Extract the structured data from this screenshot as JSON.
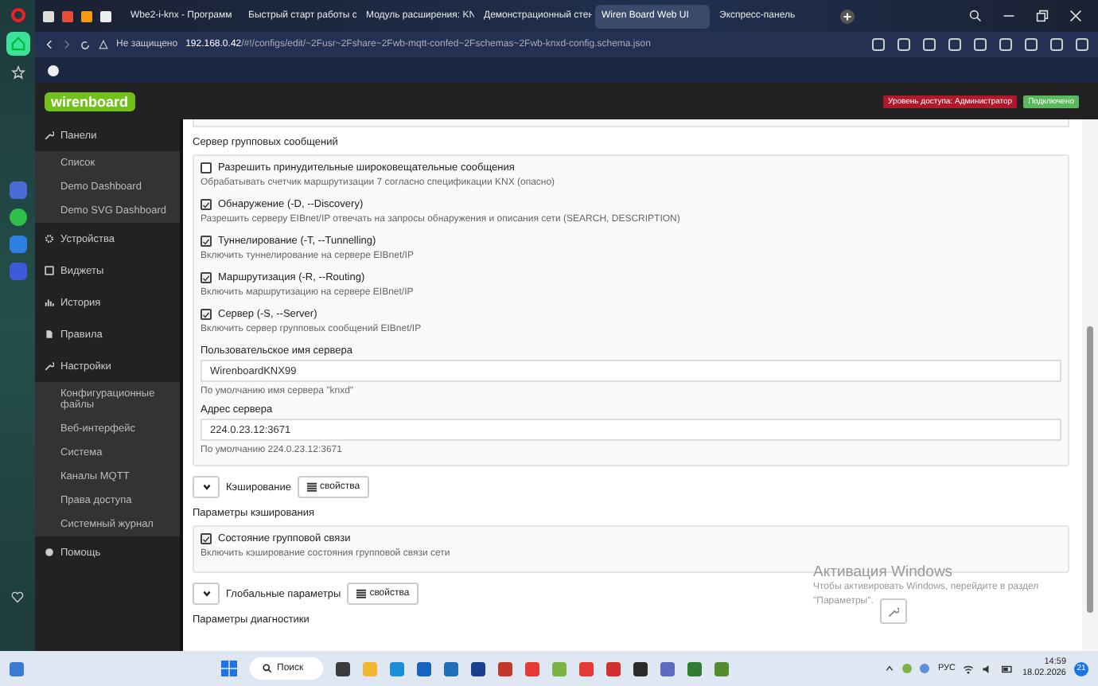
{
  "browser": {
    "tabs": [
      {
        "label": "Wbe2-i-knx - Программ",
        "selected": false
      },
      {
        "label": "Быстрый старт работы с",
        "selected": false
      },
      {
        "label": "Модуль расширения: KN",
        "selected": false
      },
      {
        "label": "Демонстрационный стен",
        "selected": false
      },
      {
        "label": "Wiren Board Web UI",
        "selected": true
      },
      {
        "label": "Экспресс-панель",
        "selected": false
      }
    ],
    "security": "Не защищено",
    "url_host": "192.168.0.42",
    "url_path": "/#!/configs/edit/~2Fusr~2Fshare~2Fwb-mqtt-confed~2Fschemas~2Fwb-knxd-config.schema.json"
  },
  "header": {
    "logo": "wirenboard",
    "access_badge": "Уровень доступа: Администратор",
    "status_badge": "Подключено"
  },
  "sidebar": {
    "items": [
      {
        "label": "Панели",
        "children": [
          {
            "label": "Список"
          },
          {
            "label": "Demo Dashboard"
          },
          {
            "label": "Demo SVG Dashboard"
          }
        ]
      },
      {
        "label": "Устройства"
      },
      {
        "label": "Виджеты"
      },
      {
        "label": "История"
      },
      {
        "label": "Правила"
      },
      {
        "label": "Настройки",
        "children": [
          {
            "label": "Конфигурационные файлы"
          },
          {
            "label": "Веб-интерфейс"
          },
          {
            "label": "Система"
          },
          {
            "label": "Каналы MQTT"
          },
          {
            "label": "Права доступа"
          },
          {
            "label": "Системный журнал"
          }
        ]
      },
      {
        "label": "Помощь"
      }
    ]
  },
  "content": {
    "section_title": "Сервер групповых сообщений",
    "options": [
      {
        "label": "Разрешить принудительные широковещательные сообщения",
        "checked": false,
        "hint": "Обрабатывать счетчик маршрутизации 7 согласно спецификации KNX (опасно)"
      },
      {
        "label": "Обнаружение (-D, --Discovery)",
        "checked": true,
        "hint": "Разрешить серверу EIBnet/IP отвечать на запросы обнаружения и описания сети (SEARCH, DESCRIPTION)"
      },
      {
        "label": "Туннелирование (-T, --Tunnelling)",
        "checked": true,
        "hint": "Включить туннелирование на сервере EIBnet/IP"
      },
      {
        "label": "Маршрутизация (-R, --Routing)",
        "checked": true,
        "hint": "Включить маршрутизацию на сервере EIBnet/IP"
      },
      {
        "label": "Сервер (-S, --Server)",
        "checked": true,
        "hint": "Включить сервер групповых сообщений EIBnet/IP"
      }
    ],
    "fields": [
      {
        "label": "Пользовательское имя сервера",
        "value": "WirenboardKNX99",
        "hint": "По умолчанию имя сервера \"knxd\""
      },
      {
        "label": "Адрес сервера",
        "value": "224.0.23.12:3671",
        "hint": "По умолчанию 224.0.23.12:3671"
      }
    ],
    "groups": [
      {
        "title": "Кэширование",
        "button": "свойства",
        "caption": "Параметры кэширования",
        "options": [
          {
            "label": "Состояние групповой связи",
            "checked": true,
            "hint": "Включить кэширование состояния групповой связи сети"
          }
        ]
      },
      {
        "title": "Глобальные параметры",
        "button": "свойства",
        "caption": "Параметры диагностики"
      }
    ]
  },
  "os_notice": {
    "title": "Активация Windows",
    "text": "Чтобы активировать Windows, перейдите в раздел \"Параметры\"."
  },
  "taskbar": {
    "search": "Поиск",
    "language": "РУС",
    "time": "14:59",
    "date": "18.02.2026",
    "notifications": "21"
  }
}
